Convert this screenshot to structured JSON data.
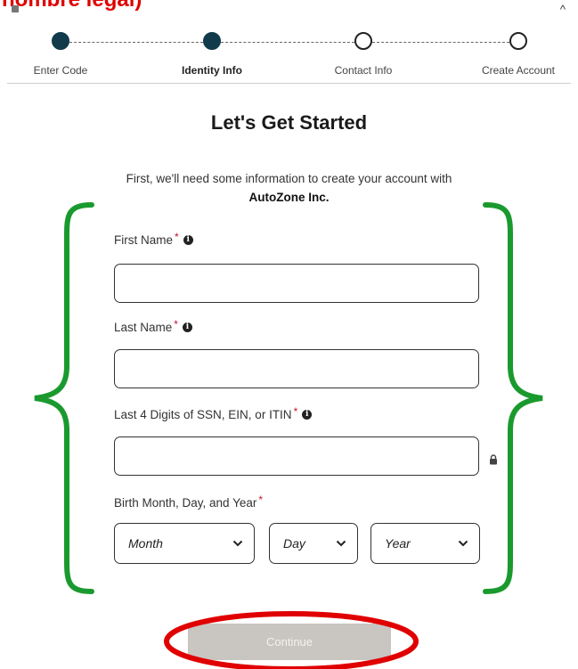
{
  "caption": "nombre legal)",
  "stepper": {
    "steps": [
      {
        "label": "Enter Code",
        "state": "done"
      },
      {
        "label": "Identity Info",
        "state": "current"
      },
      {
        "label": "Contact Info",
        "state": "todo"
      },
      {
        "label": "Create Account",
        "state": "todo"
      }
    ]
  },
  "title": "Let's Get Started",
  "intro": {
    "text": "First, we'll need some information to create your account with",
    "company": "AutoZone Inc."
  },
  "form": {
    "required_mark": "*",
    "info_glyph": "i",
    "first_name_label": "First Name",
    "last_name_label": "Last Name",
    "ssn_label": "Last 4 Digits of SSN, EIN, or ITIN",
    "birth_label": "Birth Month, Day, and Year",
    "first_name_value": "",
    "last_name_value": "",
    "ssn_value": "",
    "month_placeholder": "Month",
    "day_placeholder": "Day",
    "year_placeholder": "Year"
  },
  "continue_label": "Continue",
  "colors": {
    "step_filled": "#113a4b",
    "brace_green": "#1a9a2e",
    "annotation_red": "#e00000",
    "button_disabled": "#c9c5c1"
  }
}
